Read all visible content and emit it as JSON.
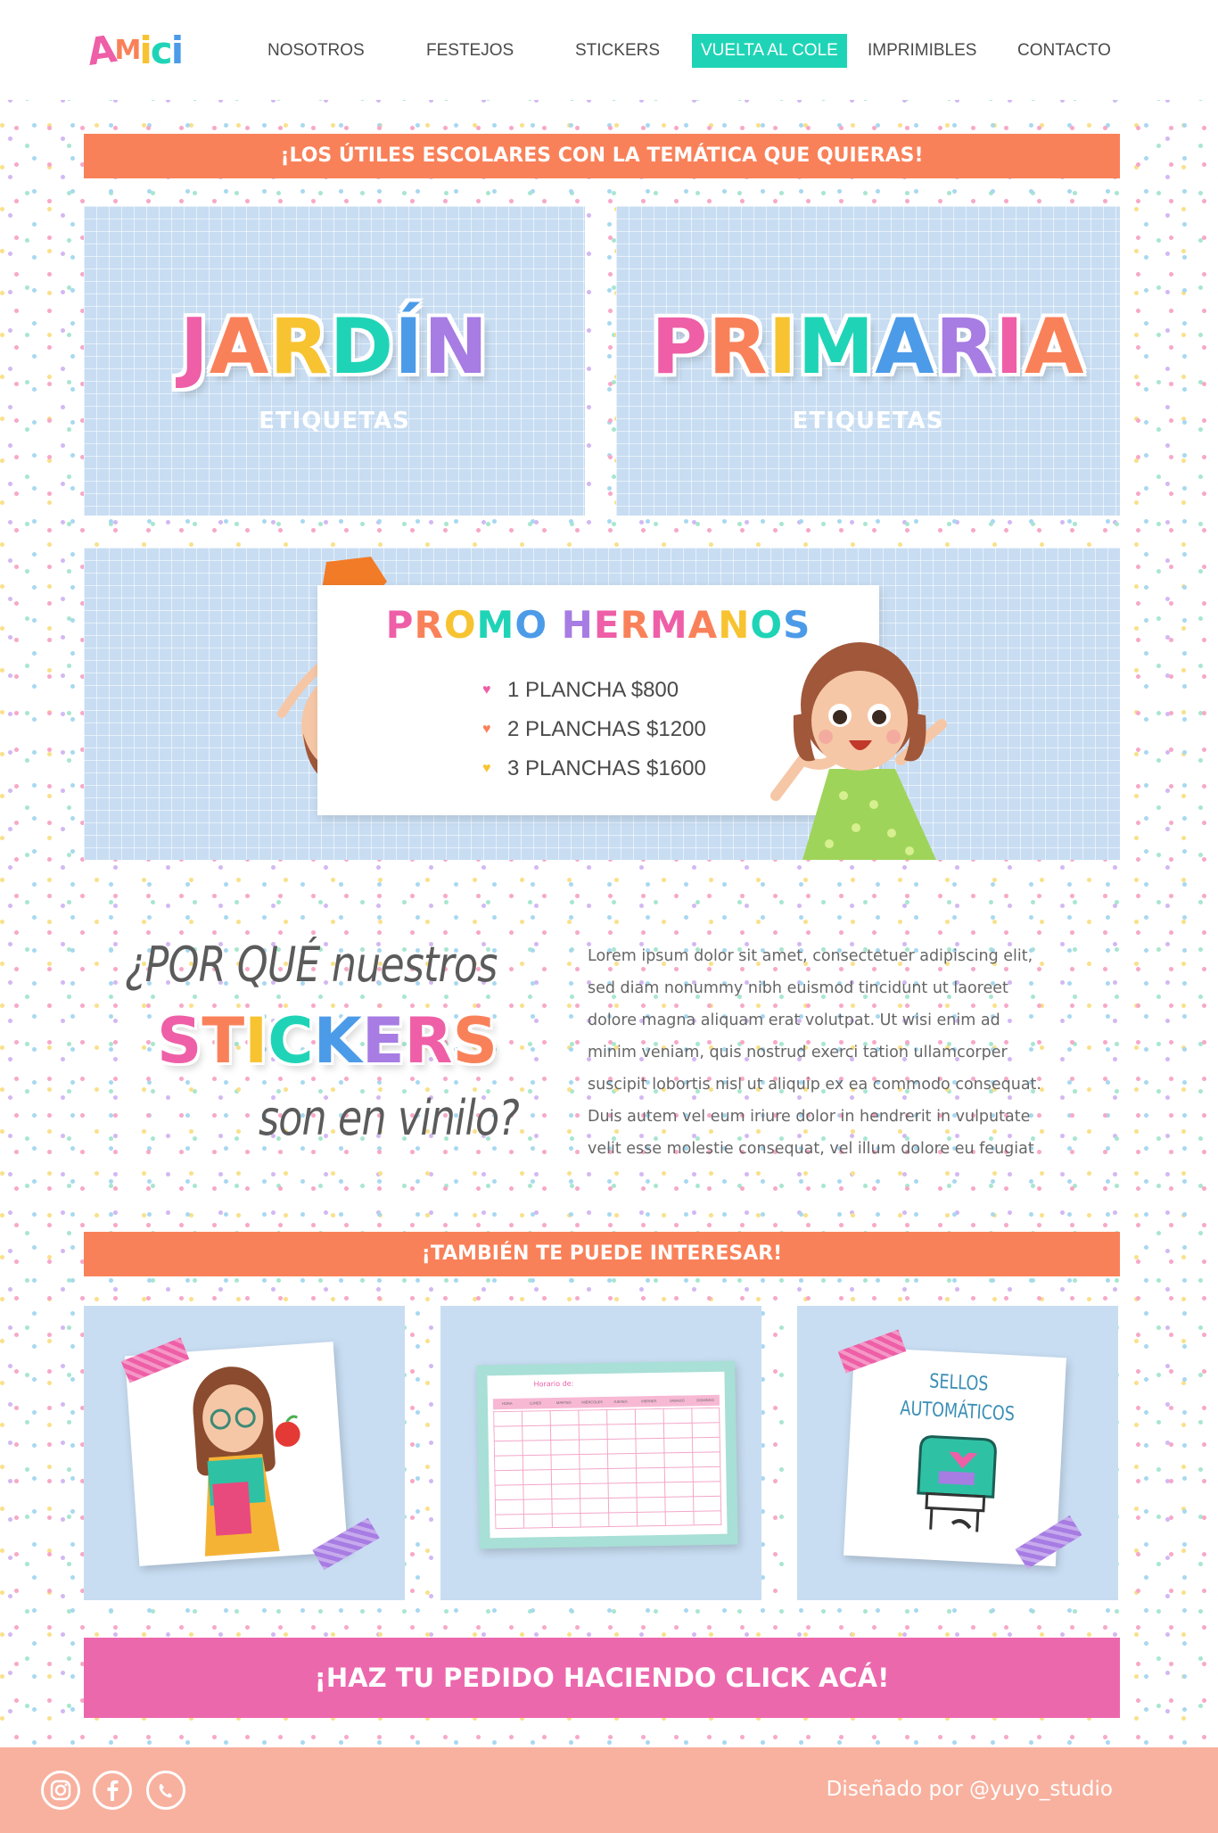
{
  "brand": {
    "logo_letters": [
      "A",
      "M",
      "i",
      "c",
      "i"
    ],
    "logo_colors": [
      "#ee5fa7",
      "#f98159",
      "#f7c331",
      "#1fd4b6",
      "#4c9be8"
    ]
  },
  "nav": {
    "items": [
      {
        "label": "NOSOTROS"
      },
      {
        "label": "FESTEJOS"
      },
      {
        "label": "STICKERS"
      },
      {
        "label": "VUELTA AL COLE",
        "active": true
      },
      {
        "label": "IMPRIMIBLES"
      },
      {
        "label": "CONTACTO"
      }
    ]
  },
  "hero_banner": "¡LOS ÚTILES ESCOLARES CON LA TEMÁTICA QUE QUIERAS!",
  "levels": [
    {
      "title": "JARDÍN",
      "subtitle": "ETIQUETAS"
    },
    {
      "title": "PRIMARIA",
      "subtitle": "ETIQUETAS"
    }
  ],
  "rainbow": [
    "#ee5fa7",
    "#f98159",
    "#f7c331",
    "#1fd4b6",
    "#4c9be8",
    "#a77ce3",
    "#ee5fa7",
    "#f98159"
  ],
  "promo": {
    "title": "PROMO HERMANOS",
    "items": [
      {
        "text": "1 PLANCHA $800",
        "heart_color": "#ee5fa7"
      },
      {
        "text": "2 PLANCHAS $1200",
        "heart_color": "#f98159"
      },
      {
        "text": "3 PLANCHAS $1600",
        "heart_color": "#f7c331"
      }
    ]
  },
  "why": {
    "line1": "¿POR QUÉ nuestros",
    "line2": "STICKERS",
    "line3": "son en vinilo?",
    "body": "Lorem ipsum dolor sit amet, consectetuer adipiscing elit, sed diam nonummy nibh euismod tincidunt ut laoreet dolore magna aliquam erat volutpat. Ut wisi enim ad minim veniam, quis nostrud exerci tation ullamcorper suscipit lobortis nisl ut aliquip ex ea commodo consequat. Duis autem vel eum iriure dolor in hendrerit in vulputate velit esse molestie consequat, vel illum dolore eu feugiat"
  },
  "also_banner": "¡TAMBIÉN TE PUEDE INTERESAR!",
  "cards": {
    "schedule_title": "Horario de:",
    "schedule_days": [
      "HORA",
      "LUNES",
      "MARTES",
      "MIÉRCOLES",
      "JUEVES",
      "VIERNES",
      "SÁBADO",
      "DOMINGO"
    ],
    "stamp_title_1": "SELLOS",
    "stamp_title_2": "AUTOMÁTICOS"
  },
  "cta": "¡HAZ TU PEDIDO HACIENDO CLICK ACÁ!",
  "footer": {
    "credit": "Diseñado por @yuyo_studio",
    "social": [
      "instagram-icon",
      "facebook-icon",
      "whatsapp-icon"
    ]
  }
}
